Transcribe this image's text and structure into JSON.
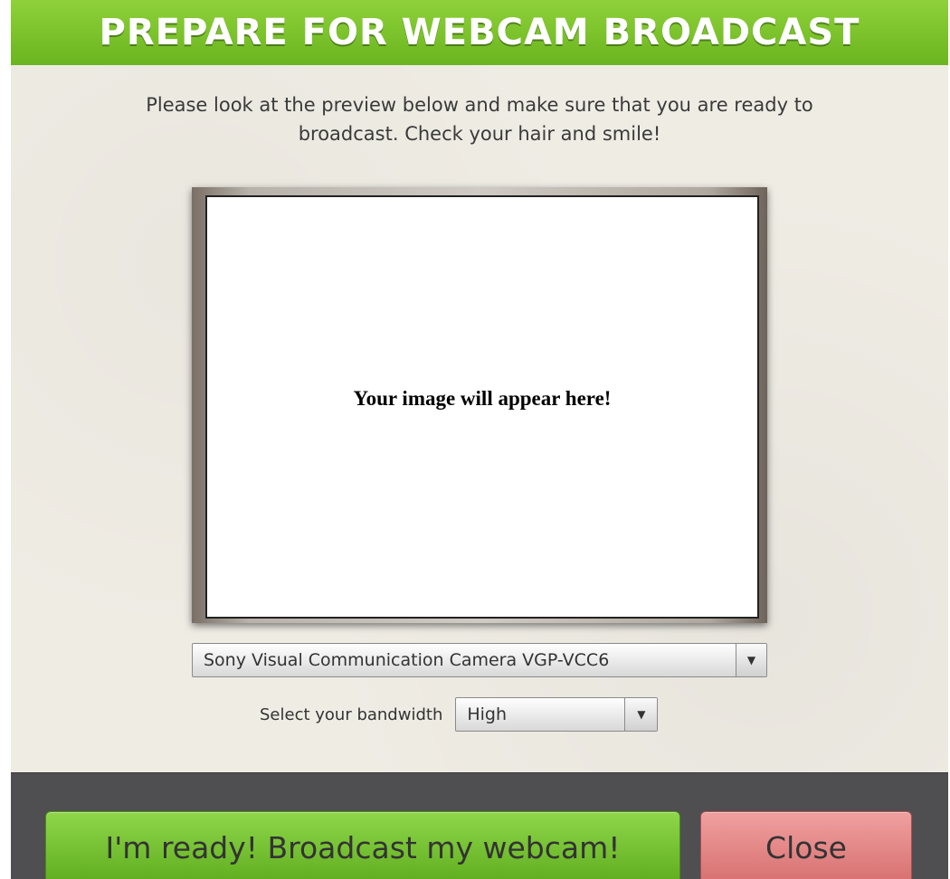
{
  "header": {
    "title": "PREPARE FOR WEBCAM BROADCAST"
  },
  "instructions": {
    "line1": "Please look at the preview below and make sure that you are ready to",
    "line2": "broadcast.  Check your hair and smile!"
  },
  "preview": {
    "message": "Your image will appear here!"
  },
  "camera_select": {
    "value": "Sony Visual Communication Camera VGP-VCC6"
  },
  "bandwidth": {
    "label": "Select your bandwidth",
    "value": "High"
  },
  "footer": {
    "ready_label": "I'm ready! Broadcast my webcam!",
    "close_label": "Close"
  },
  "colors": {
    "title_bar": "#7cc42c",
    "ready_button": "#76c236",
    "close_button": "#e48888",
    "footer_bg": "#4f4f51"
  },
  "icons": {
    "dropdown": "chevron-down-icon"
  }
}
